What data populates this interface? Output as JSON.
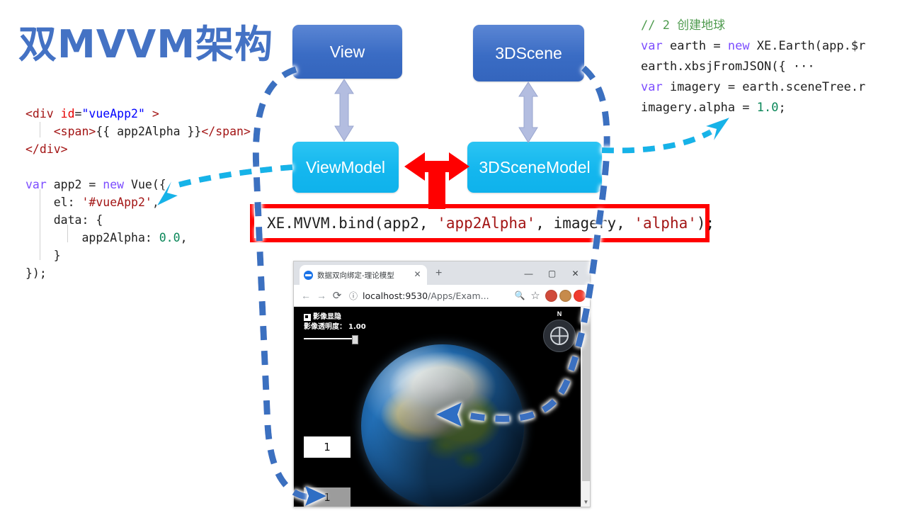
{
  "title": "双MVVM架构",
  "code_left": {
    "lines": [
      [
        {
          "t": "<div ",
          "c": "tag"
        },
        {
          "t": "id",
          "c": "attr"
        },
        {
          "t": "=",
          "c": "plain"
        },
        {
          "t": "\"vueApp2\"",
          "c": "str"
        },
        {
          "t": " >",
          "c": "tag"
        }
      ],
      [
        {
          "t": "    ",
          "c": "plain"
        },
        {
          "t": "<span>",
          "c": "tag"
        },
        {
          "t": "{{ app2Alpha }}",
          "c": "plain"
        },
        {
          "t": "</span>",
          "c": "tag"
        }
      ],
      [
        {
          "t": "</div>",
          "c": "tag"
        }
      ],
      [
        {
          "t": "",
          "c": "plain"
        }
      ],
      [
        {
          "t": "var",
          "c": "kw"
        },
        {
          "t": " app2 = ",
          "c": "plain"
        },
        {
          "t": "new",
          "c": "kw"
        },
        {
          "t": " Vue({",
          "c": "plain"
        }
      ],
      [
        {
          "t": "    el: ",
          "c": "plain"
        },
        {
          "t": "'#vueApp2'",
          "c": "str2"
        },
        {
          "t": ",",
          "c": "plain"
        }
      ],
      [
        {
          "t": "    data: {",
          "c": "plain"
        }
      ],
      [
        {
          "t": "        app2Alpha: ",
          "c": "plain"
        },
        {
          "t": "0.0",
          "c": "num"
        },
        {
          "t": ",",
          "c": "plain"
        }
      ],
      [
        {
          "t": "    }",
          "c": "plain"
        }
      ],
      [
        {
          "t": "});",
          "c": "plain"
        }
      ]
    ]
  },
  "code_right": {
    "lines": [
      [
        {
          "t": "// 2 创建地球",
          "c": "cmt"
        }
      ],
      [
        {
          "t": "var",
          "c": "kw"
        },
        {
          "t": " earth = ",
          "c": "plain"
        },
        {
          "t": "new",
          "c": "kw"
        },
        {
          "t": " XE.Earth(app.$r",
          "c": "plain"
        }
      ],
      [
        {
          "t": "earth.xbsjFromJSON({ ···",
          "c": "plain"
        }
      ],
      [
        {
          "t": "var",
          "c": "kw"
        },
        {
          "t": " imagery = earth.sceneTree.r",
          "c": "plain"
        }
      ],
      [
        {
          "t": "imagery.alpha = ",
          "c": "plain"
        },
        {
          "t": "1.0",
          "c": "num"
        },
        {
          "t": ";",
          "c": "plain"
        }
      ]
    ]
  },
  "diagram": {
    "view_label": "View",
    "scene_label": "3DScene",
    "viewmodel_label": "ViewModel",
    "scenemodel_label": "3DSceneModel",
    "colors": {
      "dark_blue": "#3a6cc4",
      "cyan": "#14b7ee",
      "red": "#ff0000",
      "arrow_gray_blue": "#b3bde0"
    }
  },
  "bind_box": {
    "segments": [
      {
        "t": "XE.MVVM.bind(app2, ",
        "c": "plain"
      },
      {
        "t": "'app2Alpha'",
        "c": "str2"
      },
      {
        "t": ", imagery, ",
        "c": "plain"
      },
      {
        "t": "'alpha'",
        "c": "str2"
      },
      {
        "t": ");",
        "c": "plain"
      }
    ]
  },
  "browser": {
    "tab_title": "数据双向绑定-理论模型",
    "tab_close": "✕",
    "new_tab": "+",
    "minimize": "—",
    "maximize": "▢",
    "close": "✕",
    "back": "←",
    "forward": "→",
    "reload": "⟳",
    "info_icon": "ⓘ",
    "url_host": "localhost:9530",
    "url_path": "/Apps/Exam...",
    "zoom_icon": "🔍",
    "star_icon": "☆",
    "scroll_up": "▲",
    "scroll_down": "▼"
  },
  "viewer": {
    "checkbox_label": "影像显隐",
    "alpha_label": "影像透明度：",
    "alpha_value": "1.00",
    "compass_north": "N",
    "white_box_value": "1",
    "gray_box_value": "1"
  }
}
